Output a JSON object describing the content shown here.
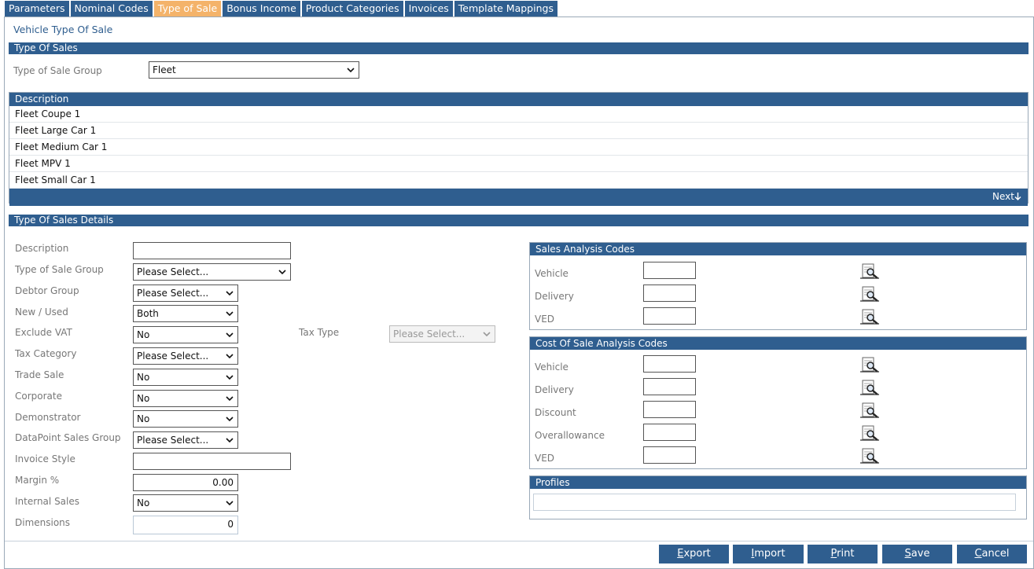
{
  "tabs": [
    "Parameters",
    "Nominal Codes",
    "Type of Sale",
    "Bonus Income",
    "Product Categories",
    "Invoices",
    "Template Mappings"
  ],
  "active_tab": "Type of Sale",
  "page_title": "Vehicle Type Of Sale",
  "type_of_sales": {
    "header": "Type Of Sales",
    "group_label": "Type of Sale Group",
    "group_value": "Fleet"
  },
  "description_list": {
    "header": "Description",
    "items": [
      "Fleet Coupe 1",
      "Fleet Large Car 1",
      "Fleet Medium Car 1",
      "Fleet MPV 1",
      "Fleet Small Car 1"
    ],
    "next_label": "Next"
  },
  "details": {
    "header": "Type Of Sales Details",
    "fields": {
      "description": {
        "label": "Description",
        "value": ""
      },
      "type_of_sale_group": {
        "label": "Type of Sale Group",
        "value": "Please Select..."
      },
      "debtor_group": {
        "label": "Debtor Group",
        "value": "Please Select..."
      },
      "new_used": {
        "label": "New / Used",
        "value": "Both"
      },
      "exclude_vat": {
        "label": "Exclude VAT",
        "value": "No"
      },
      "tax_category": {
        "label": "Tax Category",
        "value": "Please Select..."
      },
      "trade_sale": {
        "label": "Trade Sale",
        "value": "No"
      },
      "corporate": {
        "label": "Corporate",
        "value": "No"
      },
      "demonstrator": {
        "label": "Demonstrator",
        "value": "No"
      },
      "datapoint_sales_group": {
        "label": "DataPoint Sales Group",
        "value": "Please Select..."
      },
      "invoice_style": {
        "label": "Invoice Style",
        "value": ""
      },
      "margin": {
        "label": "Margin %",
        "value": "0.00"
      },
      "internal_sales": {
        "label": "Internal Sales",
        "value": "No"
      },
      "dimensions": {
        "label": "Dimensions",
        "value": "0"
      }
    },
    "tax_type": {
      "label": "Tax Type",
      "value": "Please Select..."
    }
  },
  "sales_analysis": {
    "header": "Sales Analysis Codes",
    "rows": [
      "Vehicle",
      "Delivery",
      "VED"
    ]
  },
  "cost_of_sale_analysis": {
    "header": "Cost Of Sale Analysis Codes",
    "rows": [
      "Vehicle",
      "Delivery",
      "Discount",
      "Overallowance",
      "VED"
    ]
  },
  "profiles": {
    "header": "Profiles"
  },
  "buttons": {
    "export": {
      "first": "E",
      "rest": "xport"
    },
    "import": {
      "first": "I",
      "rest": "mport"
    },
    "print": {
      "first": "P",
      "rest": "rint"
    },
    "save": {
      "first": "S",
      "rest": "ave"
    },
    "cancel": {
      "first": "C",
      "rest": "ancel"
    }
  },
  "icons": {
    "dropdown": "chevron-down-icon",
    "lookup": "magnifier-lookup-icon",
    "next": "arrow-down-icon"
  },
  "colors": {
    "header_blue": "#2f5e8f",
    "active_tab": "#f4b36a"
  }
}
